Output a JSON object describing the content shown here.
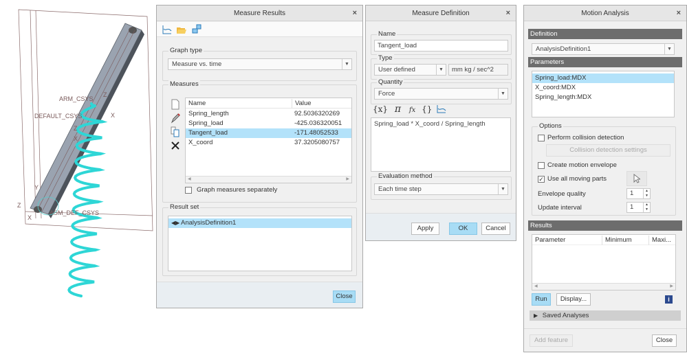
{
  "model": {
    "labels": [
      "ARM_CSYS",
      "DEFAULT_CSYS",
      "ASM_DEF_CSYS"
    ],
    "axes": [
      "Z",
      "X",
      "Z",
      "X",
      "Z",
      "Y",
      "X"
    ],
    "colors": {
      "spring": "#2ed6d6",
      "arm": "#9aa3b0",
      "frame": "#8a6a6a"
    }
  },
  "measure_results": {
    "title": "Measure Results",
    "close_x": "×",
    "toolbar": [
      "graph-icon",
      "open-folder-icon",
      "export-icon"
    ],
    "graph_type": {
      "label": "Graph type",
      "value": "Measure vs. time"
    },
    "measures": {
      "label": "Measures",
      "columns": [
        "Name",
        "Value"
      ],
      "rows": [
        {
          "name": "Spring_length",
          "value": "92.5036320269"
        },
        {
          "name": "Spring_load",
          "value": "-425.036320051"
        },
        {
          "name": "Tangent_load",
          "value": "-171.48052533"
        },
        {
          "name": "X_coord",
          "value": "37.3205080757"
        }
      ],
      "selected": "Tangent_load",
      "separate_label": "Graph measures separately"
    },
    "result_set": {
      "label": "Result set",
      "items": [
        "AnalysisDefinition1"
      ]
    },
    "close_label": "Close"
  },
  "measure_definition": {
    "title": "Measure Definition",
    "close_x": "×",
    "name": {
      "label": "Name",
      "value": "Tangent_load"
    },
    "type": {
      "label": "Type",
      "value": "User defined",
      "units": "mm kg / sec^2"
    },
    "quantity": {
      "label": "Quantity",
      "value": "Force"
    },
    "expression_tools": [
      "{x}",
      "π",
      "fx",
      "{}"
    ],
    "expression": "Spring_load * X_coord / Spring_length",
    "evaluation": {
      "label": "Evaluation method",
      "value": "Each time step"
    },
    "apply_label": "Apply",
    "ok_label": "OK",
    "cancel_label": "Cancel"
  },
  "motion_analysis": {
    "title": "Motion Analysis",
    "close_x": "×",
    "definition": {
      "label": "Definition",
      "value": "AnalysisDefinition1"
    },
    "parameters": {
      "label": "Parameters",
      "items": [
        "Spring_load:MDX",
        "X_coord:MDX",
        "Spring_length:MDX"
      ],
      "selected": "Spring_load:MDX"
    },
    "options": {
      "label": "Options",
      "collision": {
        "label": "Perform collision detection",
        "checked": false
      },
      "collision_settings": "Collision detection settings",
      "envelope": {
        "label": "Create motion envelope",
        "checked": false
      },
      "moving_parts": {
        "label": "Use all moving parts",
        "checked": true,
        "mark": "✓"
      },
      "envelope_quality": {
        "label": "Envelope quality",
        "value": "1"
      },
      "update_interval": {
        "label": "Update interval",
        "value": "1"
      }
    },
    "results": {
      "label": "Results",
      "columns": [
        "Parameter",
        "Minimum",
        "Maxi..."
      ]
    },
    "run_label": "Run",
    "display_label": "Display...",
    "info": "i",
    "saved_analyses": "Saved Analyses",
    "add_feature_label": "Add feature",
    "close_label": "Close"
  }
}
